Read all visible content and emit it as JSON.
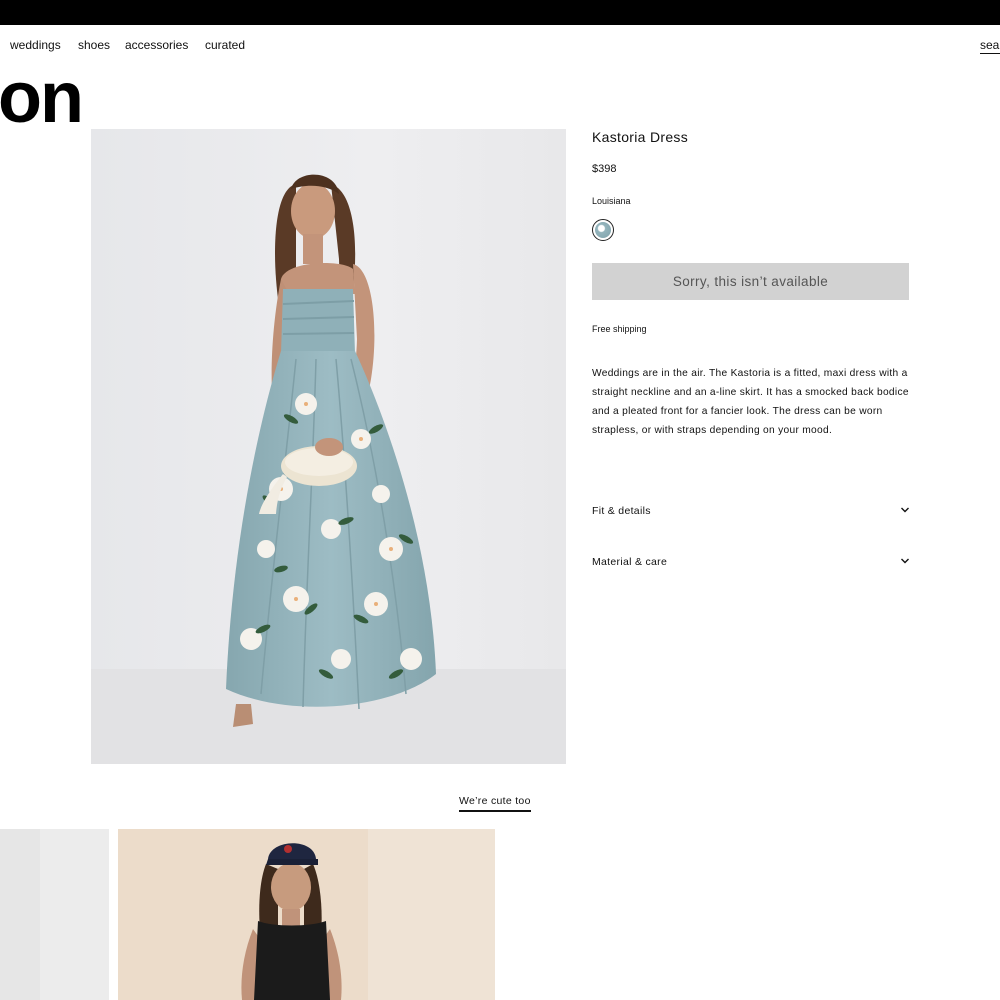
{
  "nav": {
    "items": [
      "weddings",
      "shoes",
      "accessories",
      "curated"
    ],
    "search_label": "search"
  },
  "collection": {
    "title": "on"
  },
  "product": {
    "name": "Kastoria Dress",
    "price": "$398",
    "color_label": "Louisiana",
    "unavailable_label": "Sorry, this isn’t available",
    "shipping_label": "Free shipping",
    "description": "Weddings are in the air. The Kastoria is a fitted, maxi dress with a straight neckline and an a-line skirt. It has a smocked back bodice and a pleated front for a fancier look. The dress can be worn strapless, or with straps depending on your mood.",
    "accordions": [
      "Fit & details",
      "Material & care"
    ]
  },
  "related": {
    "link_label": "We’re cute too"
  },
  "colors": {
    "topbar": "#000000",
    "button_bg": "#d2d2d2",
    "dress": "#93b3bb",
    "background": "#ffffff"
  },
  "icons": [
    "chevron-down-icon"
  ]
}
